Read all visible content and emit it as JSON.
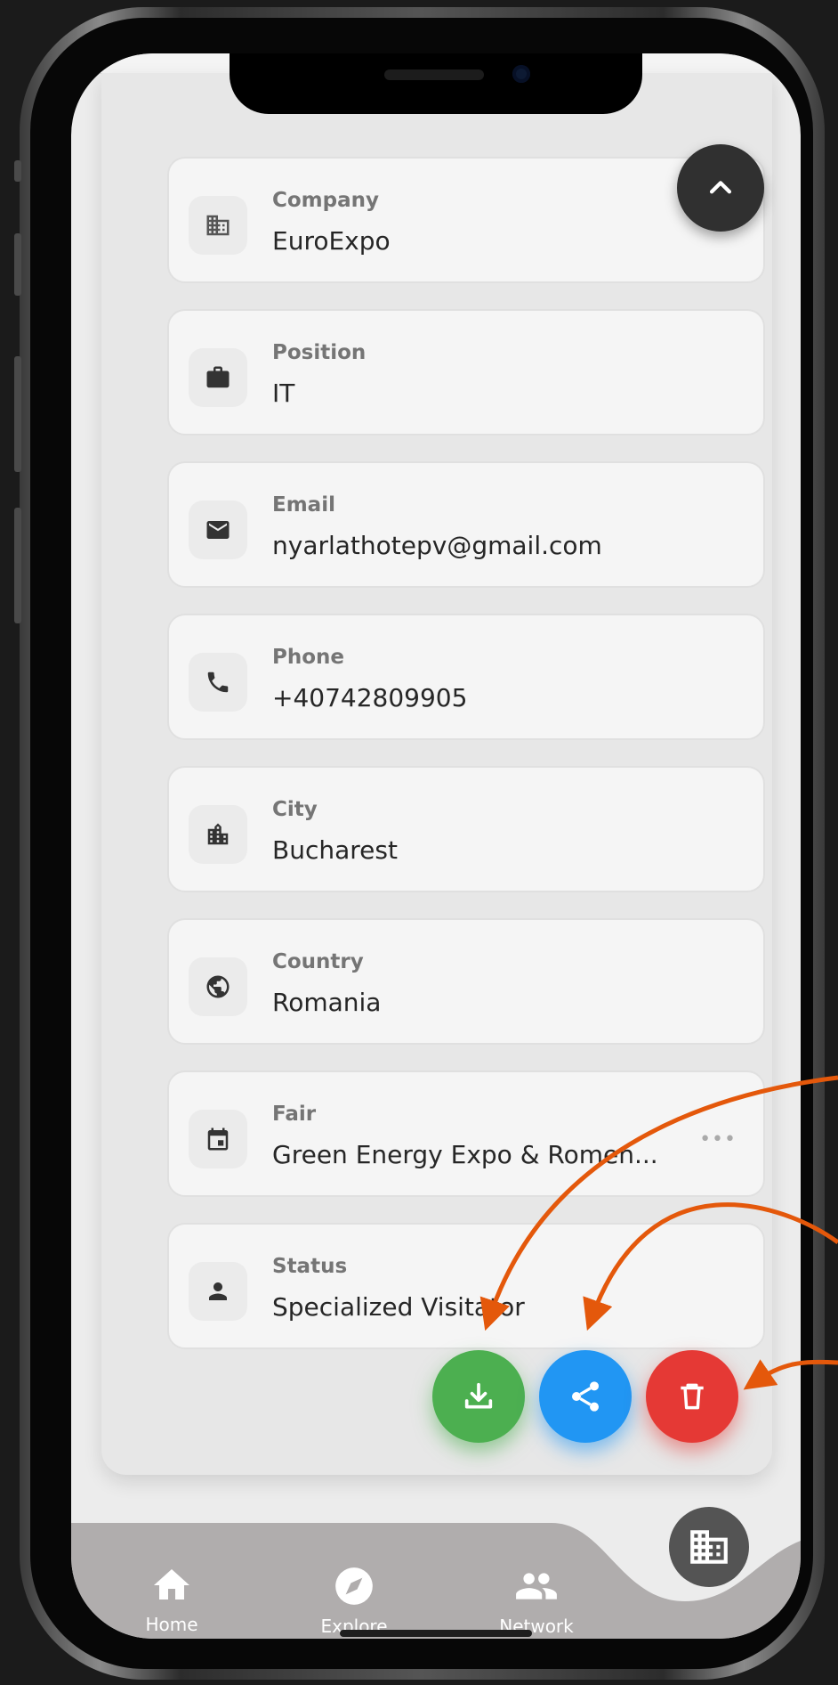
{
  "profile_fields": [
    {
      "label": "Company",
      "value": "EuroExpo",
      "icon": "building-icon"
    },
    {
      "label": "Position",
      "value": "IT",
      "icon": "briefcase-icon"
    },
    {
      "label": "Email",
      "value": "nyarlathotepv@gmail.com",
      "icon": "envelope-icon"
    },
    {
      "label": "Phone",
      "value": "+40742809905",
      "icon": "phone-icon"
    },
    {
      "label": "City",
      "value": "Bucharest",
      "icon": "city-icon"
    },
    {
      "label": "Country",
      "value": "Romania",
      "icon": "globe-icon"
    },
    {
      "label": "Fair",
      "value": "Green Energy Expo & Romen...",
      "icon": "calendar-icon",
      "more": "•••"
    },
    {
      "label": "Status",
      "value": "Specialized Visitator",
      "icon": "person-icon"
    }
  ],
  "actions": [
    {
      "name": "download",
      "icon": "download-icon",
      "color": "#4caf50"
    },
    {
      "name": "share",
      "icon": "share-icon",
      "color": "#2196f3"
    },
    {
      "name": "delete",
      "icon": "trash-icon",
      "color": "#e53935"
    }
  ],
  "bottom_nav": {
    "items": [
      {
        "label": "Home",
        "icon": "home-icon"
      },
      {
        "label": "Explore",
        "icon": "compass-icon"
      },
      {
        "label": "Network",
        "icon": "people-icon"
      }
    ],
    "center_icon": "building-icon"
  },
  "colors": {
    "annotation_arrow": "#e4580b",
    "nav_bar": "#b0adad",
    "sheet": "#e7e7e7"
  }
}
